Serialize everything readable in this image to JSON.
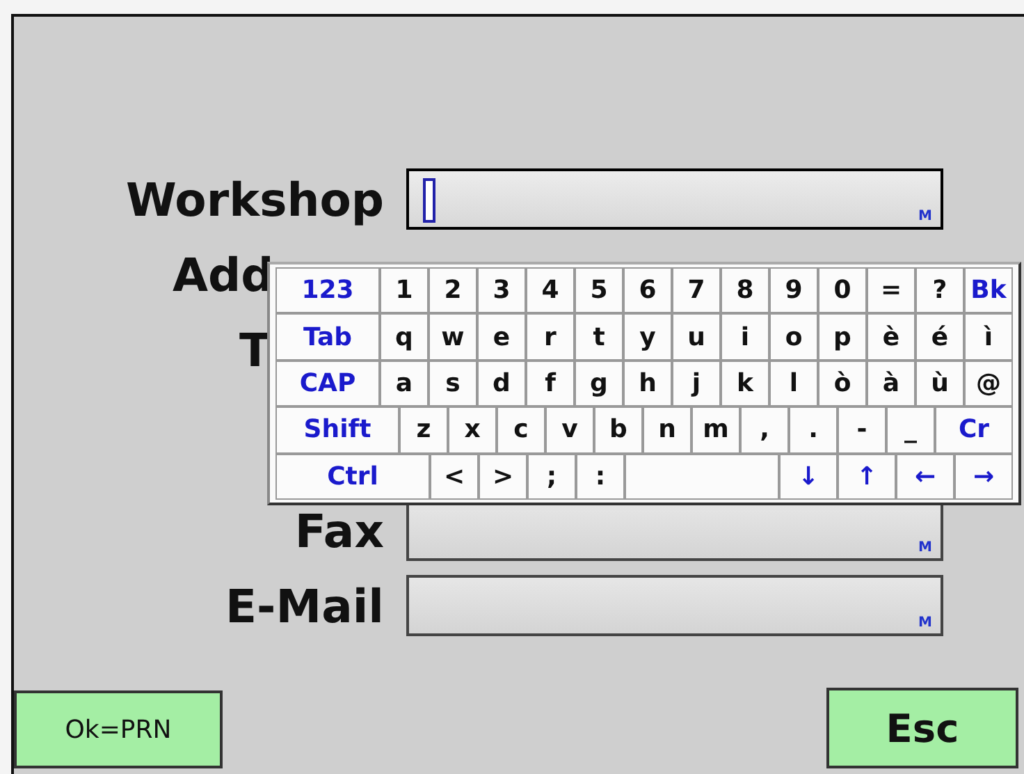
{
  "form": {
    "fields": [
      {
        "kind": "field",
        "label": "Workshop",
        "focused": true,
        "marker": "M"
      },
      {
        "kind": "label_only",
        "label": "Add"
      },
      {
        "kind": "label_only",
        "label": "T"
      },
      {
        "kind": "field",
        "label": "Fax",
        "focused": false,
        "marker": "M"
      },
      {
        "kind": "field",
        "label": "E-Mail",
        "focused": false,
        "marker": "M"
      }
    ]
  },
  "keyboard": {
    "rows": [
      {
        "keys": [
          {
            "kind": "mod",
            "label": "123"
          },
          {
            "kind": "char",
            "label": "1"
          },
          {
            "kind": "char",
            "label": "2"
          },
          {
            "kind": "char",
            "label": "3"
          },
          {
            "kind": "char",
            "label": "4"
          },
          {
            "kind": "char",
            "label": "5"
          },
          {
            "kind": "char",
            "label": "6"
          },
          {
            "kind": "char",
            "label": "7"
          },
          {
            "kind": "char",
            "label": "8"
          },
          {
            "kind": "char",
            "label": "9"
          },
          {
            "kind": "char",
            "label": "0"
          },
          {
            "kind": "char",
            "label": "="
          },
          {
            "kind": "char",
            "label": "?"
          },
          {
            "kind": "key",
            "label": "Bk"
          }
        ]
      },
      {
        "keys": [
          {
            "kind": "mod",
            "label": "Tab"
          },
          {
            "kind": "char",
            "label": "q"
          },
          {
            "kind": "char",
            "label": "w"
          },
          {
            "kind": "char",
            "label": "e"
          },
          {
            "kind": "char",
            "label": "r"
          },
          {
            "kind": "char",
            "label": "t"
          },
          {
            "kind": "char",
            "label": "y"
          },
          {
            "kind": "char",
            "label": "u"
          },
          {
            "kind": "char",
            "label": "i"
          },
          {
            "kind": "char",
            "label": "o"
          },
          {
            "kind": "char",
            "label": "p"
          },
          {
            "kind": "char",
            "label": "è"
          },
          {
            "kind": "char",
            "label": "é"
          },
          {
            "kind": "char",
            "label": "ì"
          }
        ]
      },
      {
        "keys": [
          {
            "kind": "mod",
            "label": "CAP"
          },
          {
            "kind": "char",
            "label": "a"
          },
          {
            "kind": "char",
            "label": "s"
          },
          {
            "kind": "char",
            "label": "d"
          },
          {
            "kind": "char",
            "label": "f"
          },
          {
            "kind": "char",
            "label": "g"
          },
          {
            "kind": "char",
            "label": "h"
          },
          {
            "kind": "char",
            "label": "j"
          },
          {
            "kind": "char",
            "label": "k"
          },
          {
            "kind": "char",
            "label": "l"
          },
          {
            "kind": "char",
            "label": "ò"
          },
          {
            "kind": "char",
            "label": "à"
          },
          {
            "kind": "char",
            "label": "ù"
          },
          {
            "kind": "char",
            "label": "@"
          }
        ]
      },
      {
        "keys": [
          {
            "kind": "mod",
            "label": "Shift"
          },
          {
            "kind": "char",
            "label": "z"
          },
          {
            "kind": "char",
            "label": "x"
          },
          {
            "kind": "char",
            "label": "c"
          },
          {
            "kind": "char",
            "label": "v"
          },
          {
            "kind": "char",
            "label": "b"
          },
          {
            "kind": "char",
            "label": "n"
          },
          {
            "kind": "char",
            "label": "m"
          },
          {
            "kind": "char",
            "label": ","
          },
          {
            "kind": "char",
            "label": "."
          },
          {
            "kind": "char",
            "label": "-"
          },
          {
            "kind": "char",
            "label": "_"
          },
          {
            "kind": "wide",
            "label": "Cr"
          }
        ]
      },
      {
        "keys": [
          {
            "kind": "mod",
            "label": "Ctrl"
          },
          {
            "kind": "char",
            "label": "<"
          },
          {
            "kind": "char",
            "label": ">"
          },
          {
            "kind": "char",
            "label": ";"
          },
          {
            "kind": "char",
            "label": ":"
          },
          {
            "kind": "space"
          },
          {
            "kind": "arrow",
            "label": "↓"
          },
          {
            "kind": "arrow",
            "label": "↑"
          },
          {
            "kind": "arrow",
            "label": "←"
          },
          {
            "kind": "arrow",
            "label": "→"
          }
        ]
      }
    ]
  },
  "buttons": [
    {
      "kind": "small",
      "label": "Ok=PRN"
    },
    {
      "kind": "large",
      "label": "Esc"
    }
  ]
}
